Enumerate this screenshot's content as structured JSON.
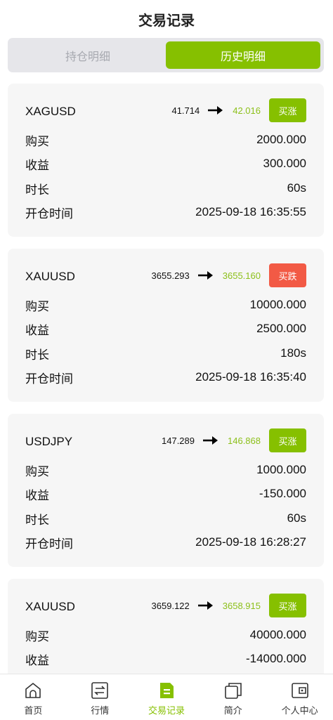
{
  "header": {
    "title": "交易记录"
  },
  "tabs": {
    "holding": "持仓明细",
    "history": "历史明细"
  },
  "labels": {
    "buy": "购买",
    "profit": "收益",
    "duration": "时长",
    "open_time": "开仓时间"
  },
  "records": [
    {
      "symbol": "XAGUSD",
      "open_price": "41.714",
      "close_price": "42.016",
      "direction": "买涨",
      "buy": "2000.000",
      "profit": "300.000",
      "duration": "60s",
      "open_time": "2025-09-18 16:35:55"
    },
    {
      "symbol": "XAUUSD",
      "open_price": "3655.293",
      "close_price": "3655.160",
      "direction": "买跌",
      "buy": "10000.000",
      "profit": "2500.000",
      "duration": "180s",
      "open_time": "2025-09-18 16:35:40"
    },
    {
      "symbol": "USDJPY",
      "open_price": "147.289",
      "close_price": "146.868",
      "direction": "买涨",
      "buy": "1000.000",
      "profit": "-150.000",
      "duration": "60s",
      "open_time": "2025-09-18 16:28:27"
    },
    {
      "symbol": "XAUUSD",
      "open_price": "3659.122",
      "close_price": "3658.915",
      "direction": "买涨",
      "buy": "40000.000",
      "profit": "-14000.000",
      "duration": "",
      "open_time": ""
    }
  ],
  "tabbar": [
    {
      "label": "首页",
      "icon": "home-icon"
    },
    {
      "label": "行情",
      "icon": "market-icon"
    },
    {
      "label": "交易记录",
      "icon": "trade-record-icon",
      "active": true
    },
    {
      "label": "简介",
      "icon": "intro-icon"
    },
    {
      "label": "个人中心",
      "icon": "wallet-icon"
    }
  ],
  "colors": {
    "accent": "#86c000",
    "down": "#f25a45",
    "close_price": "#8cc01a"
  }
}
